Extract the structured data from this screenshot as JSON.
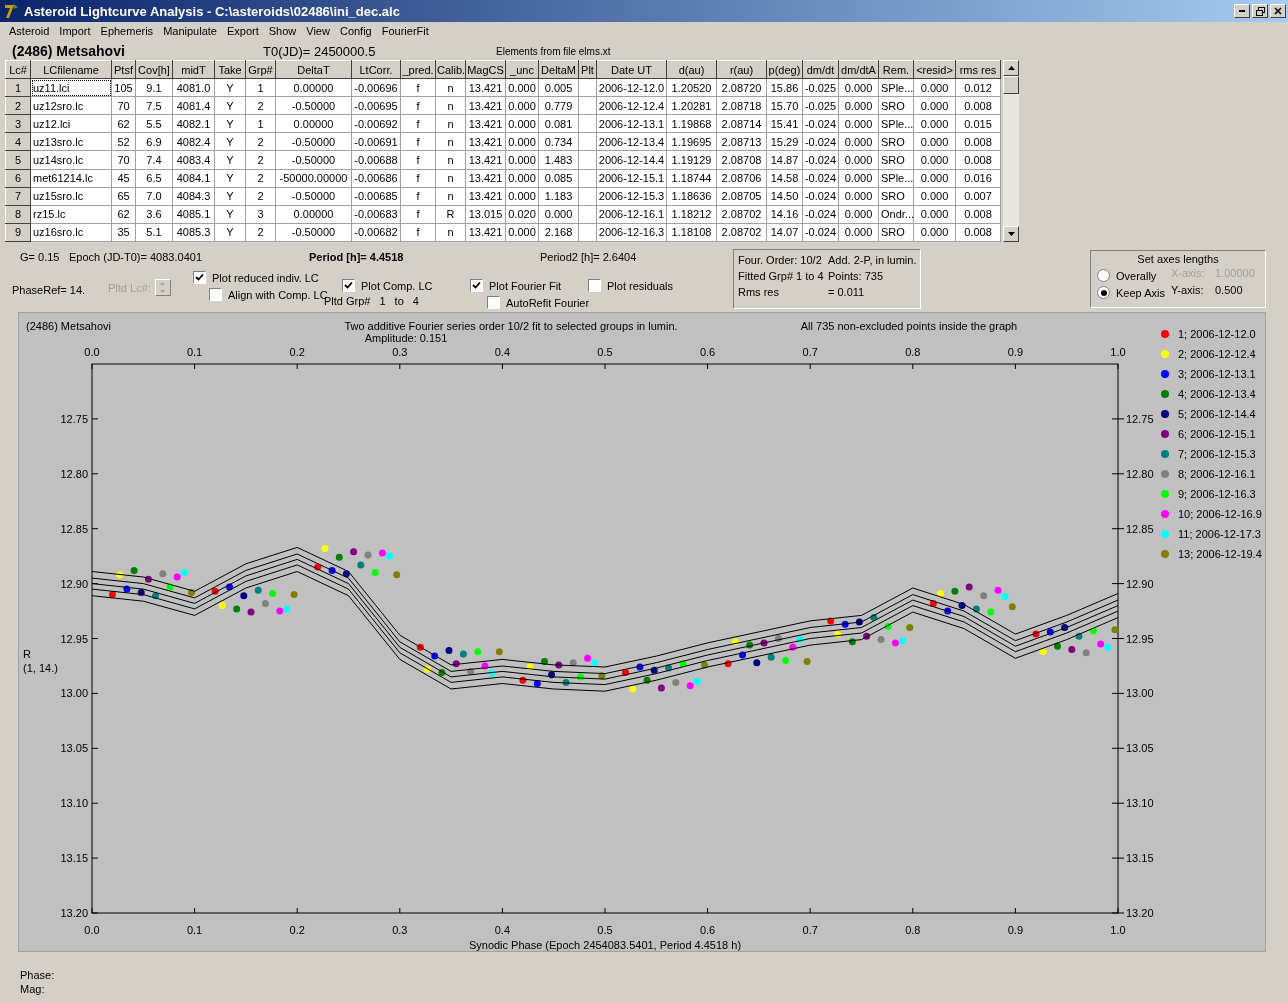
{
  "window": {
    "title": "Asteroid Lightcurve Analysis - C:\\asteroids\\02486\\ini_dec.alc"
  },
  "menu": [
    "Asteroid",
    "Import",
    "Ephemeris",
    "Manipulate",
    "Export",
    "Show",
    "View",
    "Config",
    "FourierFit"
  ],
  "header": {
    "asteroid": "(2486) Metsahovi",
    "t0": "T0(JD)= 2450000.5",
    "elements": "Elements from file elms.xt"
  },
  "table": {
    "columns": [
      "Lc#",
      "LCfilename",
      "Ptsf",
      "Cov[h]",
      "midT",
      "Take",
      "Grp#",
      "DeltaT",
      "LtCorr.",
      "_pred.",
      "Calib.",
      "MagCS",
      "_unc",
      "DeltaM",
      "Plt",
      "Date UT",
      "d(au)",
      "r(au)",
      "p(deg)",
      "dm/dt",
      "dm/dtA",
      "Rem.",
      "<resid>",
      "rms res"
    ],
    "rows": [
      {
        "cells": [
          "1",
          "uz11.lci",
          "105",
          "9.1",
          "4081.0",
          "Y",
          "1",
          "0.00000",
          "-0.00696",
          "f",
          "n",
          "13.421",
          "0.000",
          "0.005",
          "",
          "2006-12-12.0",
          "1.20520",
          "2.08720",
          "15.86",
          "-0.025",
          "0.000",
          "SPle...",
          "0.000",
          "0.012"
        ]
      },
      {
        "cells": [
          "2",
          "uz12sro.lc",
          "70",
          "7.5",
          "4081.4",
          "Y",
          "2",
          "-0.50000",
          "-0.00695",
          "f",
          "n",
          "13.421",
          "0.000",
          "0.779",
          "",
          "2006-12-12.4",
          "1.20281",
          "2.08718",
          "15.70",
          "-0.025",
          "0.000",
          "SRO",
          "0.000",
          "0.008"
        ]
      },
      {
        "cells": [
          "3",
          "uz12.lci",
          "62",
          "5.5",
          "4082.1",
          "Y",
          "1",
          "0.00000",
          "-0.00692",
          "f",
          "n",
          "13.421",
          "0.000",
          "0.081",
          "",
          "2006-12-13.1",
          "1.19868",
          "2.08714",
          "15.41",
          "-0.024",
          "0.000",
          "SPle...",
          "0.000",
          "0.015"
        ]
      },
      {
        "cells": [
          "4",
          "uz13sro.lc",
          "52",
          "6.9",
          "4082.4",
          "Y",
          "2",
          "-0.50000",
          "-0.00691",
          "f",
          "n",
          "13.421",
          "0.000",
          "0.734",
          "",
          "2006-12-13.4",
          "1.19695",
          "2.08713",
          "15.29",
          "-0.024",
          "0.000",
          "SRO",
          "0.000",
          "0.008"
        ]
      },
      {
        "cells": [
          "5",
          "uz14sro.lc",
          "70",
          "7.4",
          "4083.4",
          "Y",
          "2",
          "-0.50000",
          "-0.00688",
          "f",
          "n",
          "13.421",
          "0.000",
          "1.483",
          "",
          "2006-12-14.4",
          "1.19129",
          "2.08708",
          "14.87",
          "-0.024",
          "0.000",
          "SRO",
          "0.000",
          "0.008"
        ]
      },
      {
        "cells": [
          "6",
          "met61214.lc",
          "45",
          "6.5",
          "4084.1",
          "Y",
          "2",
          "-50000.00000",
          "-0.00686",
          "f",
          "n",
          "13.421",
          "0.000",
          "0.085",
          "",
          "2006-12-15.1",
          "1.18744",
          "2.08706",
          "14.58",
          "-0.024",
          "0.000",
          "SPle...",
          "0.000",
          "0.016"
        ]
      },
      {
        "cells": [
          "7",
          "uz15sro.lc",
          "65",
          "7.0",
          "4084.3",
          "Y",
          "2",
          "-0.50000",
          "-0.00685",
          "f",
          "n",
          "13.421",
          "0.000",
          "1.183",
          "",
          "2006-12-15.3",
          "1.18636",
          "2.08705",
          "14.50",
          "-0.024",
          "0.000",
          "SRO",
          "0.000",
          "0.007"
        ]
      },
      {
        "cells": [
          "8",
          "rz15.lc",
          "62",
          "3.6",
          "4085.1",
          "Y",
          "3",
          "0.00000",
          "-0.00683",
          "f",
          "R",
          "13.015",
          "0.020",
          "0.000",
          "",
          "2006-12-16.1",
          "1.18212",
          "2.08702",
          "14.16",
          "-0.024",
          "0.000",
          "Ondr...",
          "0.000",
          "0.008"
        ]
      },
      {
        "cells": [
          "9",
          "uz16sro.lc",
          "35",
          "5.1",
          "4085.3",
          "Y",
          "2",
          "-0.50000",
          "-0.00682",
          "f",
          "n",
          "13.421",
          "0.000",
          "2.168",
          "",
          "2006-12-16.3",
          "1.18108",
          "2.08702",
          "14.07",
          "-0.024",
          "0.000",
          "SRO",
          "0.000",
          "0.008"
        ]
      }
    ]
  },
  "parameters": {
    "g": "G= 0.15",
    "epoch": "Epoch (JD-T0)= 4083.0401",
    "period": "Period [h]= 4.4518",
    "period2": "Period2 [h]= 2.6404",
    "phase_ref": "PhaseRef= 14."
  },
  "pltd_lc": {
    "label": "Pltd Lc#:",
    "disabled": true
  },
  "checkboxes": [
    {
      "label": "Plot reduced indiv. LC",
      "checked": true
    },
    {
      "label": "Align with Comp. LC",
      "checked": false
    },
    {
      "label": "Plot Comp. LC",
      "checked": true
    },
    {
      "label": "Plot Fourier Fit",
      "checked": true
    },
    {
      "label": "AutoRefit Fourier",
      "checked": false
    },
    {
      "label": "Plot residuals",
      "checked": false
    }
  ],
  "pltd_grp": {
    "label": "Pltd Grp#",
    "from": "1",
    "to_label": "to",
    "to": "4"
  },
  "fit_info": [
    "Four. Order: 10/2",
    "Add. 2-P, in lumin.",
    "Fitted Grp# 1 to 4",
    "Points: 735",
    "Rms res",
    "= 0.011"
  ],
  "axes": {
    "title": "Set axes lengths",
    "options": [
      {
        "label": "Overally",
        "selected": false
      },
      {
        "label": "Keep Axis",
        "selected": true
      }
    ],
    "x_label": "X-axis:",
    "x_value": "1.00000",
    "x_disabled": true,
    "y_label": "Y-axis:",
    "y_value": "0.500"
  },
  "plot": {
    "object": "(2486) Metsahovi",
    "title": "Two additive Fourier series order 10/2 fit to selected groups in lumin.",
    "amplitude": "Amplitude: 0.151",
    "note": "All 735 non-excluded points inside the graph",
    "ylabel_sub": "(1, 14.)",
    "top_tick_labels": [
      "0.0",
      "0.1",
      "0.2",
      "0.3",
      "0.4",
      "0.5",
      "0.6",
      "0.7",
      "0.8",
      "0.9",
      "1.0"
    ],
    "right_tick_labels": [
      "12.75",
      "12.80",
      "12.85",
      "12.90",
      "12.95",
      "13.00",
      "13.05",
      "13.10",
      "13.15",
      "13.20"
    ],
    "chart_data": {
      "type": "scatter",
      "xlabel": "Synodic Phase (Epoch 2454083.5401, Period 4.4518 h)",
      "ylabel": "R",
      "xlim": [
        0,
        1
      ],
      "ylim": [
        13.2,
        12.7
      ],
      "legend": true,
      "xticks": [
        {
          "value": 0,
          "label": "0.0"
        },
        {
          "value": 0.1,
          "label": "0.1"
        },
        {
          "value": 0.2,
          "label": "0.2"
        },
        {
          "value": 0.3,
          "label": "0.3"
        },
        {
          "value": 0.4,
          "label": "0.4"
        },
        {
          "value": 0.5,
          "label": "0.5"
        },
        {
          "value": 0.6,
          "label": "0.6"
        },
        {
          "value": 0.7,
          "label": "0.7"
        },
        {
          "value": 0.8,
          "label": "0.8"
        },
        {
          "value": 0.9,
          "label": "0.9"
        },
        {
          "value": 1,
          "label": "1.0"
        }
      ],
      "yticks": [
        {
          "value": 12.75,
          "label": "12.75"
        },
        {
          "value": 12.8,
          "label": "12.80"
        },
        {
          "value": 12.85,
          "label": "12.85"
        },
        {
          "value": 12.9,
          "label": "12.90"
        },
        {
          "value": 12.95,
          "label": "12.95"
        },
        {
          "value": 13.0,
          "label": "13.00"
        },
        {
          "value": 13.05,
          "label": "13.05"
        },
        {
          "value": 13.1,
          "label": "13.10"
        },
        {
          "value": 13.15,
          "label": "13.15"
        },
        {
          "value": 13.2,
          "label": "13.20"
        }
      ],
      "series": [
        {
          "name": "1; 2006-12-12.0",
          "color": "#ff0000",
          "x": [
            0.02,
            0.12,
            0.22,
            0.32,
            0.42,
            0.52,
            0.62,
            0.72,
            0.82,
            0.92
          ],
          "values": [
            12.91,
            12.907,
            12.885,
            12.958,
            12.988,
            12.981,
            12.973,
            12.934,
            12.918,
            12.946
          ]
        },
        {
          "name": "2; 2006-12-12.4",
          "color": "#ffff00",
          "x": [
            0.027,
            0.127,
            0.227,
            0.327,
            0.427,
            0.527,
            0.627,
            0.727,
            0.827,
            0.927
          ],
          "values": [
            12.892,
            12.92,
            12.868,
            12.978,
            12.976,
            12.996,
            12.953,
            12.946,
            12.909,
            12.962
          ]
        },
        {
          "name": "3; 2006-12-13.1",
          "color": "#0000ff",
          "x": [
            0.034,
            0.134,
            0.234,
            0.334,
            0.434,
            0.534,
            0.634,
            0.734,
            0.834,
            0.934
          ],
          "values": [
            12.905,
            12.903,
            12.888,
            12.966,
            12.991,
            12.976,
            12.965,
            12.937,
            12.925,
            12.944
          ]
        },
        {
          "name": "4; 2006-12-13.4",
          "color": "#008000",
          "x": [
            0.041,
            0.141,
            0.241,
            0.341,
            0.441,
            0.541,
            0.641,
            0.741,
            0.841,
            0.941
          ],
          "values": [
            12.888,
            12.923,
            12.876,
            12.981,
            12.971,
            12.988,
            12.956,
            12.953,
            12.907,
            12.957
          ]
        },
        {
          "name": "5; 2006-12-14.4",
          "color": "#000080",
          "x": [
            0.048,
            0.148,
            0.248,
            0.348,
            0.448,
            0.548,
            0.648,
            0.748,
            0.848,
            0.948
          ],
          "values": [
            12.908,
            12.911,
            12.891,
            12.961,
            12.983,
            12.979,
            12.972,
            12.935,
            12.92,
            12.94
          ]
        },
        {
          "name": "6; 2006-12-15.1",
          "color": "#800080",
          "x": [
            0.055,
            0.155,
            0.255,
            0.355,
            0.455,
            0.555,
            0.655,
            0.755,
            0.855,
            0.955
          ],
          "values": [
            12.896,
            12.926,
            12.871,
            12.973,
            12.974,
            12.995,
            12.954,
            12.948,
            12.903,
            12.96
          ]
        },
        {
          "name": "7; 2006-12-15.3",
          "color": "#008080",
          "x": [
            0.062,
            0.162,
            0.262,
            0.362,
            0.462,
            0.562,
            0.662,
            0.762,
            0.862,
            0.962
          ],
          "values": [
            12.911,
            12.906,
            12.883,
            12.964,
            12.99,
            12.977,
            12.967,
            12.931,
            12.923,
            12.948
          ]
        },
        {
          "name": "8; 2006-12-16.1",
          "color": "#808080",
          "x": [
            0.069,
            0.169,
            0.269,
            0.369,
            0.469,
            0.569,
            0.669,
            0.769,
            0.869,
            0.969
          ],
          "values": [
            12.891,
            12.918,
            12.874,
            12.98,
            12.972,
            12.99,
            12.95,
            12.951,
            12.911,
            12.963
          ]
        },
        {
          "name": "9; 2006-12-16.3",
          "color": "#00ff00",
          "x": [
            0.076,
            0.176,
            0.276,
            0.376,
            0.476,
            0.576,
            0.676,
            0.776,
            0.876,
            0.976
          ],
          "values": [
            12.903,
            12.909,
            12.89,
            12.962,
            12.985,
            12.973,
            12.97,
            12.939,
            12.926,
            12.943
          ]
        },
        {
          "name": "10; 2006-12-16.9",
          "color": "#ff00ff",
          "x": [
            0.083,
            0.183,
            0.283,
            0.383,
            0.483,
            0.583,
            0.683,
            0.783,
            0.883,
            0.983
          ],
          "values": [
            12.894,
            12.925,
            12.872,
            12.975,
            12.968,
            12.993,
            12.958,
            12.954,
            12.906,
            12.955
          ]
        },
        {
          "name": "11; 2006-12-17.3",
          "color": "#00ffff",
          "x": [
            0.09,
            0.19,
            0.29,
            0.39,
            0.49,
            0.59,
            0.69,
            0.79,
            0.89,
            0.99
          ],
          "values": [
            12.89,
            12.923,
            12.875,
            12.982,
            12.972,
            12.989,
            12.951,
            12.952,
            12.912,
            12.958
          ]
        },
        {
          "name": "13; 2006-12-19.4",
          "color": "#808000",
          "x": [
            0.097,
            0.197,
            0.297,
            0.397,
            0.497,
            0.597,
            0.697,
            0.797,
            0.897,
            0.997
          ],
          "values": [
            12.908,
            12.91,
            12.892,
            12.962,
            12.984,
            12.974,
            12.971,
            12.94,
            12.921,
            12.942
          ]
        },
        {
          "type": "line",
          "color": "#000000",
          "x": [
            0,
            0.05,
            0.1,
            0.15,
            0.2,
            0.25,
            0.3,
            0.35,
            0.4,
            0.45,
            0.5,
            0.55,
            0.6,
            0.65,
            0.7,
            0.75,
            0.8,
            0.85,
            0.9,
            0.95,
            1
          ],
          "values": [
            12.889,
            12.894,
            12.907,
            12.882,
            12.867,
            12.889,
            12.947,
            12.974,
            12.969,
            12.974,
            12.976,
            12.966,
            12.954,
            12.944,
            12.934,
            12.929,
            12.904,
            12.919,
            12.946,
            12.929,
            12.909
          ]
        },
        {
          "type": "line",
          "color": "#000000",
          "x": [
            0,
            0.05,
            0.1,
            0.15,
            0.2,
            0.25,
            0.3,
            0.35,
            0.4,
            0.45,
            0.5,
            0.55,
            0.6,
            0.65,
            0.7,
            0.75,
            0.8,
            0.85,
            0.9,
            0.95,
            1
          ],
          "values": [
            12.895,
            12.9,
            12.913,
            12.888,
            12.873,
            12.895,
            12.953,
            12.98,
            12.975,
            12.98,
            12.982,
            12.972,
            12.96,
            12.95,
            12.94,
            12.935,
            12.91,
            12.925,
            12.952,
            12.935,
            12.915
          ]
        },
        {
          "type": "line",
          "color": "#000000",
          "x": [
            0,
            0.05,
            0.1,
            0.15,
            0.2,
            0.25,
            0.3,
            0.35,
            0.4,
            0.45,
            0.5,
            0.55,
            0.6,
            0.65,
            0.7,
            0.75,
            0.8,
            0.85,
            0.9,
            0.95,
            1
          ],
          "values": [
            12.9,
            12.905,
            12.918,
            12.893,
            12.878,
            12.9,
            12.958,
            12.985,
            12.98,
            12.985,
            12.987,
            12.977,
            12.965,
            12.955,
            12.945,
            12.94,
            12.915,
            12.93,
            12.957,
            12.94,
            12.92
          ]
        },
        {
          "type": "line",
          "color": "#000000",
          "x": [
            0,
            0.05,
            0.1,
            0.15,
            0.2,
            0.25,
            0.3,
            0.35,
            0.4,
            0.45,
            0.5,
            0.55,
            0.6,
            0.65,
            0.7,
            0.75,
            0.8,
            0.85,
            0.9,
            0.95,
            1
          ],
          "values": [
            12.905,
            12.91,
            12.923,
            12.898,
            12.883,
            12.905,
            12.963,
            12.99,
            12.985,
            12.99,
            12.992,
            12.982,
            12.97,
            12.96,
            12.95,
            12.945,
            12.92,
            12.935,
            12.962,
            12.945,
            12.925
          ]
        },
        {
          "type": "line",
          "color": "#000000",
          "x": [
            0,
            0.05,
            0.1,
            0.15,
            0.2,
            0.25,
            0.3,
            0.35,
            0.4,
            0.45,
            0.5,
            0.55,
            0.6,
            0.65,
            0.7,
            0.75,
            0.8,
            0.85,
            0.9,
            0.95,
            1
          ],
          "values": [
            12.911,
            12.916,
            12.929,
            12.904,
            12.889,
            12.911,
            12.969,
            12.996,
            12.991,
            12.996,
            12.998,
            12.988,
            12.976,
            12.966,
            12.956,
            12.951,
            12.926,
            12.941,
            12.968,
            12.951,
            12.931
          ]
        }
      ]
    }
  },
  "status": [
    "Phase:",
    "Mag:"
  ]
}
